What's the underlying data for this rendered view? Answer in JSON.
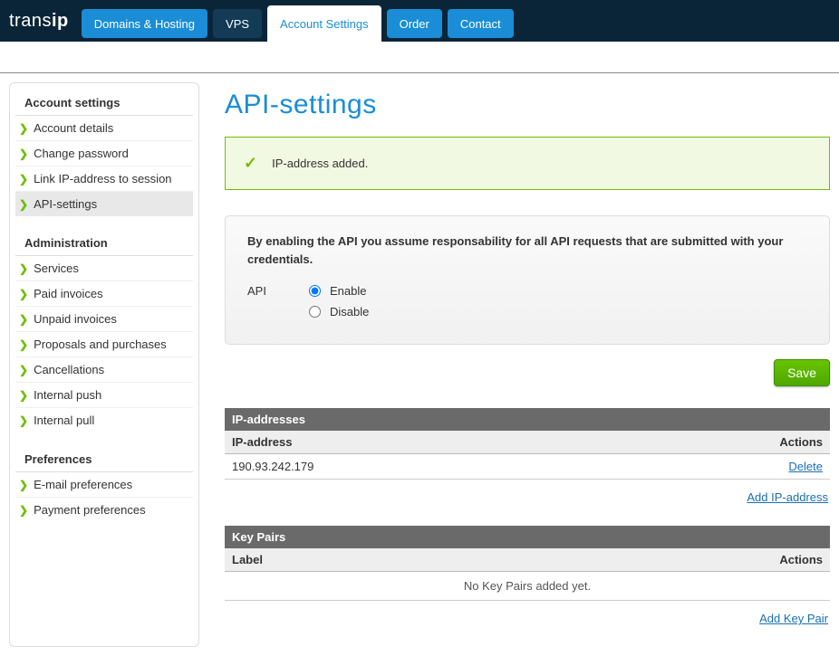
{
  "brand": {
    "part1": "trans",
    "part2": "ip"
  },
  "nav": {
    "domains": "Domains & Hosting",
    "vps": "VPS",
    "account": "Account Settings",
    "order": "Order",
    "contact": "Contact"
  },
  "sidebar": {
    "account_heading": "Account settings",
    "account_items": [
      "Account details",
      "Change password",
      "Link IP-address to session",
      "API-settings"
    ],
    "admin_heading": "Administration",
    "admin_items": [
      "Services",
      "Paid invoices",
      "Unpaid invoices",
      "Proposals and purchases",
      "Cancellations",
      "Internal push",
      "Internal pull"
    ],
    "pref_heading": "Preferences",
    "pref_items": [
      "E-mail preferences",
      "Payment preferences"
    ]
  },
  "page": {
    "title": "API-settings",
    "alert": "IP-address added.",
    "panel_text": "By enabling the API you assume responsability for all API requests that are submitted with your credentials.",
    "api_label": "API",
    "enable": "Enable",
    "disable": "Disable",
    "save": "Save"
  },
  "ip_table": {
    "title": "IP-addresses",
    "col_ip": "IP-address",
    "col_actions": "Actions",
    "rows": [
      {
        "ip": "190.93.242.179",
        "action": "Delete"
      }
    ],
    "add": "Add IP-address"
  },
  "key_table": {
    "title": "Key Pairs",
    "col_label": "Label",
    "col_actions": "Actions",
    "empty": "No Key Pairs added yet.",
    "add": "Add Key Pair"
  }
}
